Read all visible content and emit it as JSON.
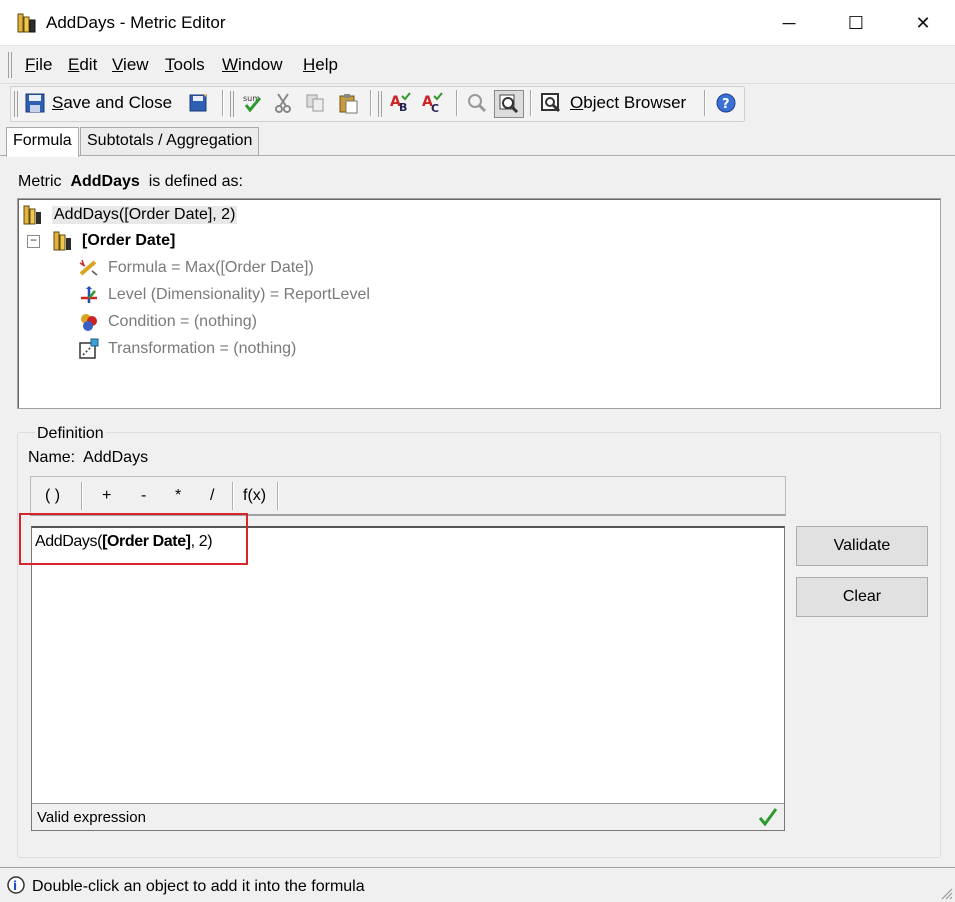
{
  "window": {
    "title": "AddDays - Metric Editor",
    "minimize": "─",
    "maximize": "☐",
    "close": "✕"
  },
  "menu": {
    "items": [
      {
        "label": "File",
        "hot": "F",
        "rest": "ile"
      },
      {
        "label": "Edit",
        "hot": "E",
        "rest": "dit"
      },
      {
        "label": "View",
        "hot": "V",
        "rest": "iew"
      },
      {
        "label": "Tools",
        "hot": "T",
        "rest": "ools"
      },
      {
        "label": "Window",
        "hot": "W",
        "rest": "indow"
      },
      {
        "label": "Help",
        "hot": "H",
        "rest": "elp"
      }
    ]
  },
  "toolbar": {
    "save_close_hot": "S",
    "save_close_rest": "ave and Close",
    "object_browser_hot": "O",
    "object_browser_rest": "bject Browser"
  },
  "tabs": [
    {
      "label": "Formula",
      "active": true
    },
    {
      "label": "Subtotals / Aggregation",
      "active": false
    }
  ],
  "metric": {
    "prefix": "Metric",
    "name": "AddDays",
    "suffix": "is defined as:"
  },
  "tree": {
    "root": "AddDays([Order Date], 2)",
    "child": "[Order Date]",
    "props": [
      {
        "label": "Formula = Max([Order Date])",
        "icon": "formula-icon"
      },
      {
        "label": "Level (Dimensionality) = ReportLevel",
        "icon": "level-icon"
      },
      {
        "label": "Condition = (nothing)",
        "icon": "condition-icon"
      },
      {
        "label": "Transformation = (nothing)",
        "icon": "transformation-icon"
      }
    ]
  },
  "definition": {
    "legend": "Definition",
    "name_label": "Name:",
    "name_value": "AddDays",
    "operators": [
      "( )",
      "+",
      "-",
      "*",
      "/",
      "f(x)"
    ],
    "expr_prefix": "AddDays(",
    "expr_bold": "[Order Date]",
    "expr_suffix": ", 2)",
    "status": "Valid expression",
    "validate": "Validate",
    "clear": "Clear"
  },
  "statusbar": {
    "text": "Double-click an object to add it into the formula"
  },
  "colors": {
    "highlight": "#d6262c",
    "valid_check": "#2e9a2e",
    "panel_bg": "#f0f0f0"
  }
}
